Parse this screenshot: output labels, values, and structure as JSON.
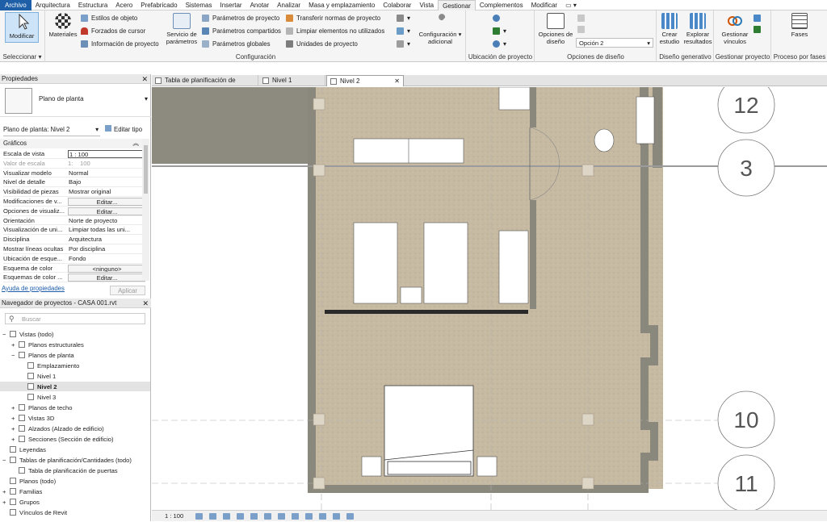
{
  "menu": [
    "Archivo",
    "Arquitectura",
    "Estructura",
    "Acero",
    "Prefabricado",
    "Sistemas",
    "Insertar",
    "Anotar",
    "Analizar",
    "Masa y emplazamiento",
    "Colaborar",
    "Vista",
    "Gestionar",
    "Complementos",
    "Modificar"
  ],
  "ribbon": {
    "modify": "Modificar",
    "select_label": "Seleccionar",
    "materials": "Materiales",
    "object_styles": "Estilos de objeto",
    "cursor_snaps": "Forzados de cursor",
    "project_info": "Información de proyecto",
    "project_params": "Parámetros de proyecto",
    "shared_params": "Parámetros compartidos",
    "global_params": "Parámetros globales",
    "transfer_standards": "Transferir normas de proyecto",
    "purge_unused": "Limpiar elementos no utilizados",
    "project_units": "Unidades de proyecto",
    "params_service_1": "Servicio de",
    "params_service_2": "parámetros",
    "additional_settings_1": "Configuración",
    "additional_settings_2": "adicional",
    "settings_label": "Configuración",
    "location_label": "Ubicación de proyecto",
    "design_options_1": "Opciones de",
    "design_options_2": "diseño",
    "option_value": "Opción 2",
    "design_options_label": "Opciones de diseño",
    "create_study_1": "Crear",
    "create_study_2": "estudio",
    "explore_results_1": "Explorar",
    "explore_results_2": "resultados",
    "generative_label": "Diseño generativo",
    "manage_links_1": "Gestionar",
    "manage_links_2": "vínculos",
    "manage_project_label": "Gestionar proyecto",
    "phases": "Fases",
    "phasing_label": "Proceso por fases"
  },
  "properties": {
    "title": "Propiedades",
    "type_name": "Plano de planta",
    "instance_selector": "Plano de planta: Nivel 2",
    "edit_type": "Editar tipo",
    "section": "Gráficos",
    "rows": [
      {
        "k": "Escala de vista",
        "v": "1 : 100"
      },
      {
        "k": "Valor de escala",
        "v": "100",
        "extra": "1:"
      },
      {
        "k": "Visualizar modelo",
        "v": "Normal"
      },
      {
        "k": "Nivel de detalle",
        "v": "Bajo"
      },
      {
        "k": "Visibilidad de piezas",
        "v": "Mostrar original"
      },
      {
        "k": "Modificaciones de v...",
        "v": "Editar..."
      },
      {
        "k": "Opciones de visualiz...",
        "v": "Editar..."
      },
      {
        "k": "Orientación",
        "v": "Norte de proyecto"
      },
      {
        "k": "Visualización de uni...",
        "v": "Limpiar todas las uni..."
      },
      {
        "k": "Disciplina",
        "v": "Arquitectura"
      },
      {
        "k": "Mostrar líneas ocultas",
        "v": "Por disciplina"
      },
      {
        "k": "Ubicación de esque...",
        "v": "Fondo"
      },
      {
        "k": "Esquema de color",
        "v": "<ninguno>"
      },
      {
        "k": "Esquemas de color ...",
        "v": "Editar..."
      }
    ],
    "help_link": "Ayuda de propiedades",
    "apply": "Aplicar"
  },
  "browser": {
    "title": "Navegador de proyectos - CASA 001.rvt",
    "search_placeholder": "Buscar",
    "items": [
      {
        "label": "Vistas (todo)",
        "level": 0,
        "exp": "−"
      },
      {
        "label": "Planos estructurales",
        "level": 1,
        "exp": "+"
      },
      {
        "label": "Planos de planta",
        "level": 1,
        "exp": "−"
      },
      {
        "label": "Emplazamiento",
        "level": 2,
        "exp": ""
      },
      {
        "label": "Nivel 1",
        "level": 2,
        "exp": ""
      },
      {
        "label": "Nivel 2",
        "level": 2,
        "exp": "",
        "selected": true
      },
      {
        "label": "Nivel 3",
        "level": 2,
        "exp": ""
      },
      {
        "label": "Planos de techo",
        "level": 1,
        "exp": "+"
      },
      {
        "label": "Vistas 3D",
        "level": 1,
        "exp": "+"
      },
      {
        "label": "Alzados (Alzado de edificio)",
        "level": 1,
        "exp": "+"
      },
      {
        "label": "Secciones (Sección de edificio)",
        "level": 1,
        "exp": "+"
      },
      {
        "label": "Leyendas",
        "level": 0,
        "exp": ""
      },
      {
        "label": "Tablas de planificación/Cantidades (todo)",
        "level": 0,
        "exp": "−"
      },
      {
        "label": "Tabla de planificación de puertas",
        "level": 1,
        "exp": ""
      },
      {
        "label": "Planos (todo)",
        "level": 0,
        "exp": ""
      },
      {
        "label": "Familias",
        "level": 0,
        "exp": "+"
      },
      {
        "label": "Grupos",
        "level": 0,
        "exp": "+"
      },
      {
        "label": "Vínculos de Revit",
        "level": 0,
        "exp": ""
      }
    ]
  },
  "tabs": [
    "Tabla de planificación de puertas",
    "Nivel 1",
    "Nivel 2"
  ],
  "grid_labels": [
    "12",
    "3",
    "10",
    "11"
  ],
  "status": {
    "scale": "1 : 100"
  },
  "colors": {
    "file_tab": "#1f5fa8",
    "floor": "#c9bca6",
    "wall": "#8a877c",
    "select_blue": "#cde3f7"
  }
}
